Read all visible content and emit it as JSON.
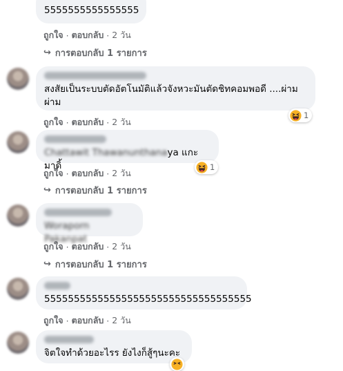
{
  "comments": [
    {
      "text": "5555555555555555",
      "actions": {
        "like": "ถูกใจ",
        "reply": "ตอบกลับ",
        "time": "2 วัน"
      },
      "replies": "การตอบกลับ 1 รายการ"
    },
    {
      "text": "สงสัยเป็นระบบตัดอัตโนมัติแล้วจังหวะมันตัดชิทคอมพอดี ....ผ่ามผ่าม",
      "reaction_count": "1",
      "actions": {
        "like": "ถูกใจ",
        "reply": "ตอบกลับ",
        "time": "2 วัน"
      }
    },
    {
      "text_suffix": "ya แกะมาดิ้",
      "reaction_count": "1",
      "actions": {
        "like": "ถูกใจ",
        "reply": "ตอบกลับ",
        "time": "2 วัน"
      },
      "replies": "การตอบกลับ 1 รายการ"
    },
    {
      "actions": {
        "like": "ถูกใจ",
        "reply": "ตอบกลับ",
        "time": "2 วัน"
      },
      "replies": "การตอบกลับ 1 รายการ"
    },
    {
      "text": "55555555555555555555555555555555555",
      "actions": {
        "like": "ถูกใจ",
        "reply": "ตอบกลับ",
        "time": "2 วัน"
      }
    },
    {
      "text": "จิตใจทำด้วยอะไรร ยังไงก็สู้ๆนะคะ"
    }
  ],
  "colors": {
    "bubble": "#f0f2f5",
    "meta": "#65676b",
    "text": "#050505"
  },
  "icons": {
    "reaction": "haha-emoji-icon",
    "reply_arrow": "reply-arrow-icon"
  }
}
